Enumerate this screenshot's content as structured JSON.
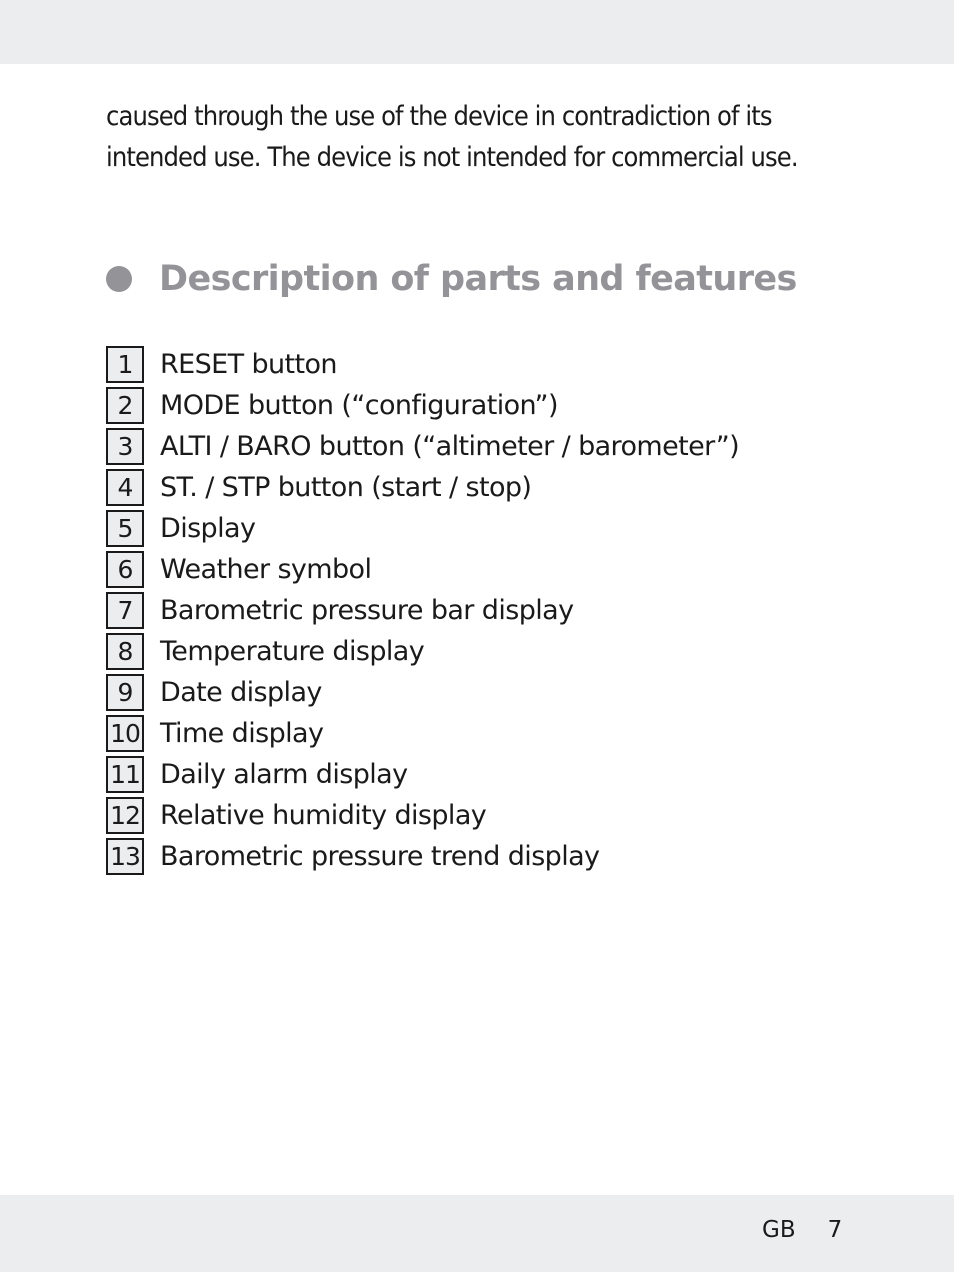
{
  "intro": {
    "lines": [
      "caused through the use of the device in contradiction of its",
      "intended use. The device is not intended for commercial use."
    ]
  },
  "section": {
    "bullet_icon": "filled-circle-bullet",
    "title": "Description of parts and features",
    "accent_color": "#939398"
  },
  "parts": [
    {
      "number": "1",
      "label": "RESET button"
    },
    {
      "number": "2",
      "label": "MODE button (“configuration”)"
    },
    {
      "number": "3",
      "label": "ALTI / BARO button (“altimeter / barometer”)"
    },
    {
      "number": "4",
      "label": "ST. / STP button (start / stop)"
    },
    {
      "number": "5",
      "label": "Display"
    },
    {
      "number": "6",
      "label": "Weather symbol"
    },
    {
      "number": "7",
      "label": "Barometric pressure bar display"
    },
    {
      "number": "8",
      "label": "Temperature display"
    },
    {
      "number": "9",
      "label": "Date display"
    },
    {
      "number": "10",
      "label": "Time display"
    },
    {
      "number": "11",
      "label": "Daily alarm display"
    },
    {
      "number": "12",
      "label": "Relative humidity display"
    },
    {
      "number": "13",
      "label": "Barometric pressure trend display"
    }
  ],
  "footer": {
    "language": "GB",
    "page_number": "7"
  }
}
